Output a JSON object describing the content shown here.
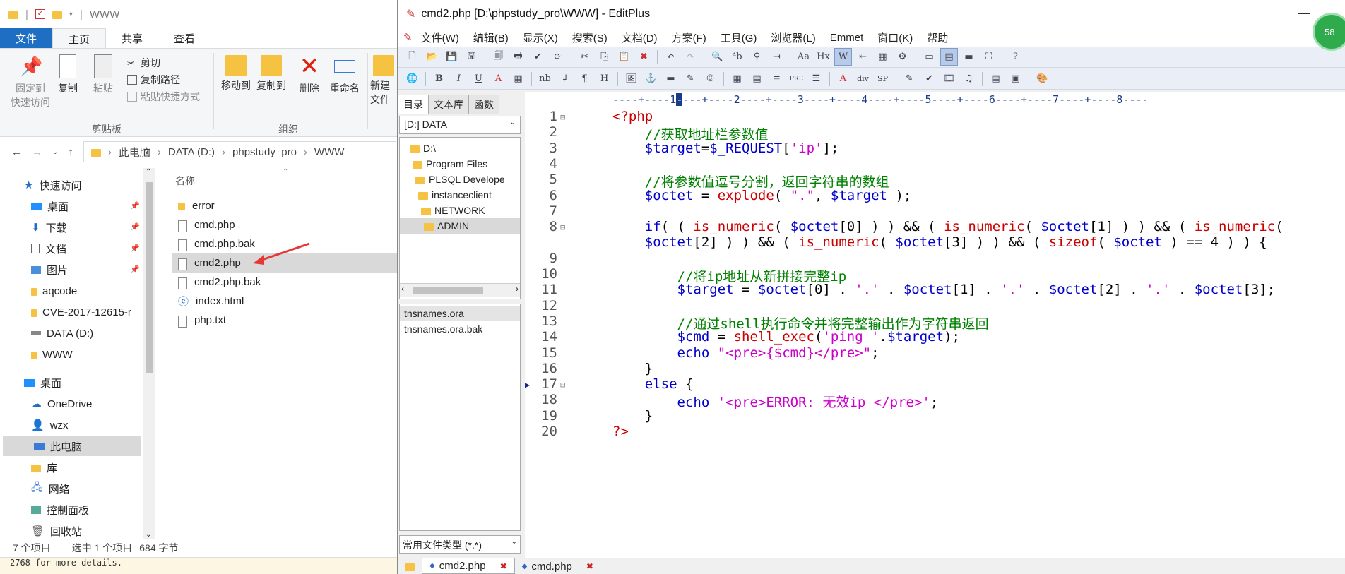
{
  "explorer": {
    "title": "WWW",
    "tabs": [
      "文件",
      "主页",
      "共享",
      "查看"
    ],
    "ribbon": {
      "pin": "固定到\n快速访问",
      "copy": "复制",
      "paste": "粘贴",
      "cut": "剪切",
      "copy_path": "复制路径",
      "paste_shortcut": "粘贴快捷方式",
      "move_to": "移动到",
      "copy_to": "复制到",
      "delete": "删除",
      "rename": "重命名",
      "new": "新建\n文件",
      "group_clipboard": "剪贴板",
      "group_organize": "组织"
    },
    "breadcrumb": [
      "此电脑",
      "DATA (D:)",
      "phpstudy_pro",
      "WWW"
    ],
    "nav": [
      {
        "label": "快速访问",
        "icon": "star-icon"
      },
      {
        "label": "桌面",
        "icon": "desktop-icon",
        "pinned": true
      },
      {
        "label": "下载",
        "icon": "download-icon",
        "pinned": true
      },
      {
        "label": "文档",
        "icon": "document-icon",
        "pinned": true
      },
      {
        "label": "图片",
        "icon": "picture-icon",
        "pinned": true
      },
      {
        "label": "aqcode",
        "icon": "folder-icon"
      },
      {
        "label": "CVE-2017-12615-r",
        "icon": "folder-icon"
      },
      {
        "label": "DATA (D:)",
        "icon": "drive-icon"
      },
      {
        "label": "WWW",
        "icon": "folder-icon"
      },
      {
        "label": "桌面",
        "icon": "desktop-icon"
      },
      {
        "label": "OneDrive",
        "icon": "cloud-icon"
      },
      {
        "label": "wzx",
        "icon": "user-icon"
      },
      {
        "label": "此电脑",
        "icon": "computer-icon",
        "selected": true
      },
      {
        "label": "库",
        "icon": "library-icon"
      },
      {
        "label": "网络",
        "icon": "network-icon"
      },
      {
        "label": "控制面板",
        "icon": "control-panel-icon"
      },
      {
        "label": "回收站",
        "icon": "recycle-bin-icon"
      }
    ],
    "column_header": "名称",
    "files": [
      {
        "name": "error",
        "type": "folder"
      },
      {
        "name": "cmd.php",
        "type": "file"
      },
      {
        "name": "cmd.php.bak",
        "type": "file"
      },
      {
        "name": "cmd2.php",
        "type": "file",
        "selected": true
      },
      {
        "name": "cmd2.php.bak",
        "type": "file"
      },
      {
        "name": "index.html",
        "type": "html"
      },
      {
        "name": "php.txt",
        "type": "file"
      }
    ],
    "status": {
      "count": "7 个项目",
      "selected": "选中 1 个项目",
      "size": "684 字节"
    },
    "bottom_text": "2768 for more details."
  },
  "editplus": {
    "title": "cmd2.php [D:\\phpstudy_pro\\WWW] - EditPlus",
    "menu": [
      "文件(W)",
      "编辑(B)",
      "显示(X)",
      "搜索(S)",
      "文档(D)",
      "方案(F)",
      "工具(G)",
      "浏览器(L)",
      "Emmet",
      "窗口(K)",
      "帮助"
    ],
    "sidebar_tabs": [
      "目录",
      "文本库",
      "函数"
    ],
    "drive": "[D:] DATA",
    "tree": [
      "D:\\",
      "Program Files",
      "PLSQL Develope",
      "instanceclient",
      "NETWORK",
      "ADMIN"
    ],
    "file_list": [
      "tnsnames.ora",
      "tnsnames.ora.bak"
    ],
    "filter": "常用文件类型 (*.*)",
    "ruler": "----+----1----+----2----+----3----+----4----+----5----+----6----+----7----+----8----",
    "doc_tabs": [
      "cmd2.php",
      "cmd.php"
    ],
    "badge": "58"
  },
  "code_lines": [
    {
      "n": "1",
      "text": "<?php"
    },
    {
      "n": "2",
      "text": "    //获取地址栏参数值"
    },
    {
      "n": "3",
      "text": "    $target=$_REQUEST['ip'];"
    },
    {
      "n": "4",
      "text": ""
    },
    {
      "n": "5",
      "text": "    //将参数值逗号分割，返回字符串的数组"
    },
    {
      "n": "6",
      "text": "    $octet = explode( \".\", $target );"
    },
    {
      "n": "7",
      "text": ""
    },
    {
      "n": "8",
      "text": "    if( ( is_numeric( $octet[0] ) ) && ( is_numeric( $octet[1] ) ) && ( is_numeric("
    },
    {
      "n": "",
      "text": "    $octet[2] ) ) && ( is_numeric( $octet[3] ) ) && ( sizeof( $octet ) == 4 ) ) {"
    },
    {
      "n": "9",
      "text": ""
    },
    {
      "n": "10",
      "text": "        //将ip地址从新拼接完整ip"
    },
    {
      "n": "11",
      "text": "        $target = $octet[0] . '.' . $octet[1] . '.' . $octet[2] . '.' . $octet[3];"
    },
    {
      "n": "12",
      "text": ""
    },
    {
      "n": "13",
      "text": "        //通过shell执行命令并将完整输出作为字符串返回"
    },
    {
      "n": "14",
      "text": "        $cmd = shell_exec('ping '.$target);"
    },
    {
      "n": "15",
      "text": "        echo \"<pre>{$cmd}</pre>\";"
    },
    {
      "n": "16",
      "text": "    }"
    },
    {
      "n": "17",
      "text": "    else {"
    },
    {
      "n": "18",
      "text": "        echo '<pre>ERROR: 无效ip </pre>';"
    },
    {
      "n": "19",
      "text": "    }"
    },
    {
      "n": "20",
      "text": "?>"
    }
  ]
}
